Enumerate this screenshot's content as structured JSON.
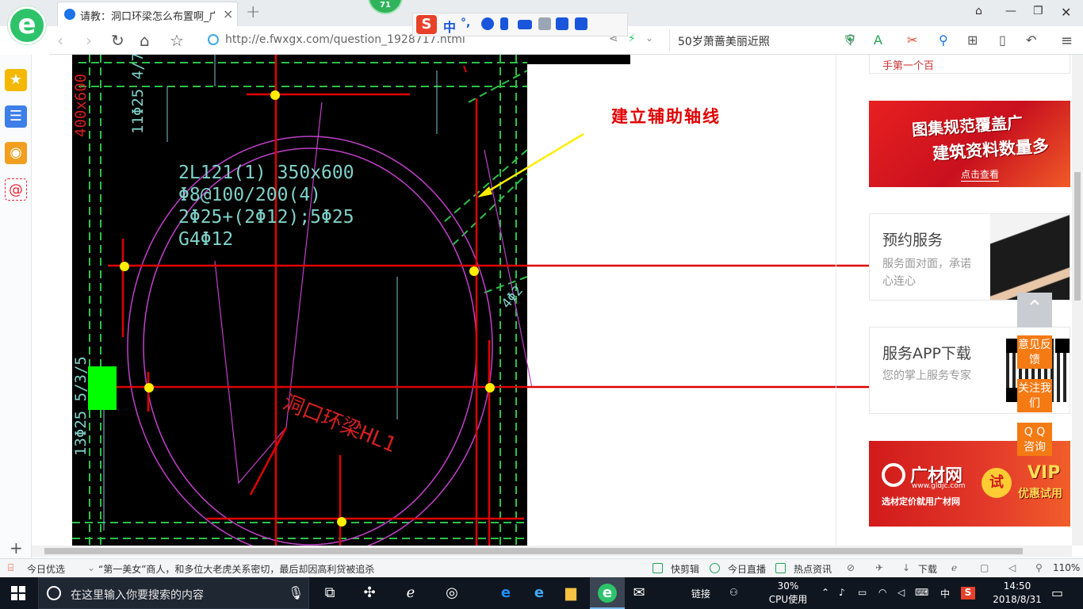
{
  "browser": {
    "tab_title": "请教：洞口环梁怎么布置啊_广联",
    "tab_close": "×",
    "new_tab": "+",
    "badge": "71",
    "url": "http://e.fwxgx.com/question_1928717.html",
    "search_text": "50岁萧蔷美丽近照",
    "ime_label": "中",
    "ime_dot": "°,"
  },
  "cad": {
    "annotation": "建立辅助轴线",
    "spec_lines": [
      "2L121(1) 350x600",
      "Φ8@100/200(4)",
      "2Φ25+(2Φ12);5Φ25",
      "G4Φ12"
    ],
    "beam_label": "洞口环梁HL1",
    "left_red_vertical": "400x600",
    "left_green_vertical": "11Φ25 4/7",
    "bottom_left_vertical": "13Φ25 5/3/5",
    "small_right_label": "4Φ2"
  },
  "sidebar_cards": [
    {
      "title": "图集规范覆盖广",
      "subtitle": "建筑资料数量多",
      "button": "点击查看"
    },
    {
      "title": "预约服务",
      "desc": "服务面对面，承诺心连心"
    },
    {
      "title": "服务APP下载",
      "desc": "您的掌上服务专家"
    },
    {
      "brand": "广材网",
      "domain": "www.gldjc.com",
      "slogan": "选材定价就用广材网",
      "trial": "试",
      "vip": "VIP",
      "vip_sub": "优惠试用"
    }
  ],
  "top_partial_text": "手第一个百",
  "float_buttons": [
    "意见反馈",
    "关注我们",
    "Q Q 咨询"
  ],
  "float_top": "⌃",
  "statusbar": {
    "left_label": "今日优选",
    "news": "“第一美女”商人，和多位大老虎关系密切，最后却因高利贷被追杀",
    "items": [
      "快剪辑",
      "今日直播",
      "热点资讯",
      "下载"
    ],
    "zoom": "110%"
  },
  "taskbar": {
    "search_placeholder": "在这里输入你要搜索的内容",
    "link_label": "链接",
    "cpu_percent": "30%",
    "cpu_label": "CPU使用",
    "ime_zh": "中",
    "time": "14:50",
    "date": "2018/8/31"
  },
  "colors": {
    "accent_green": "#2ec36a",
    "cad_red": "#e00000",
    "cad_magenta": "#c040c8",
    "cad_yellow": "#ffee00",
    "float_orange": "#f47a14"
  }
}
